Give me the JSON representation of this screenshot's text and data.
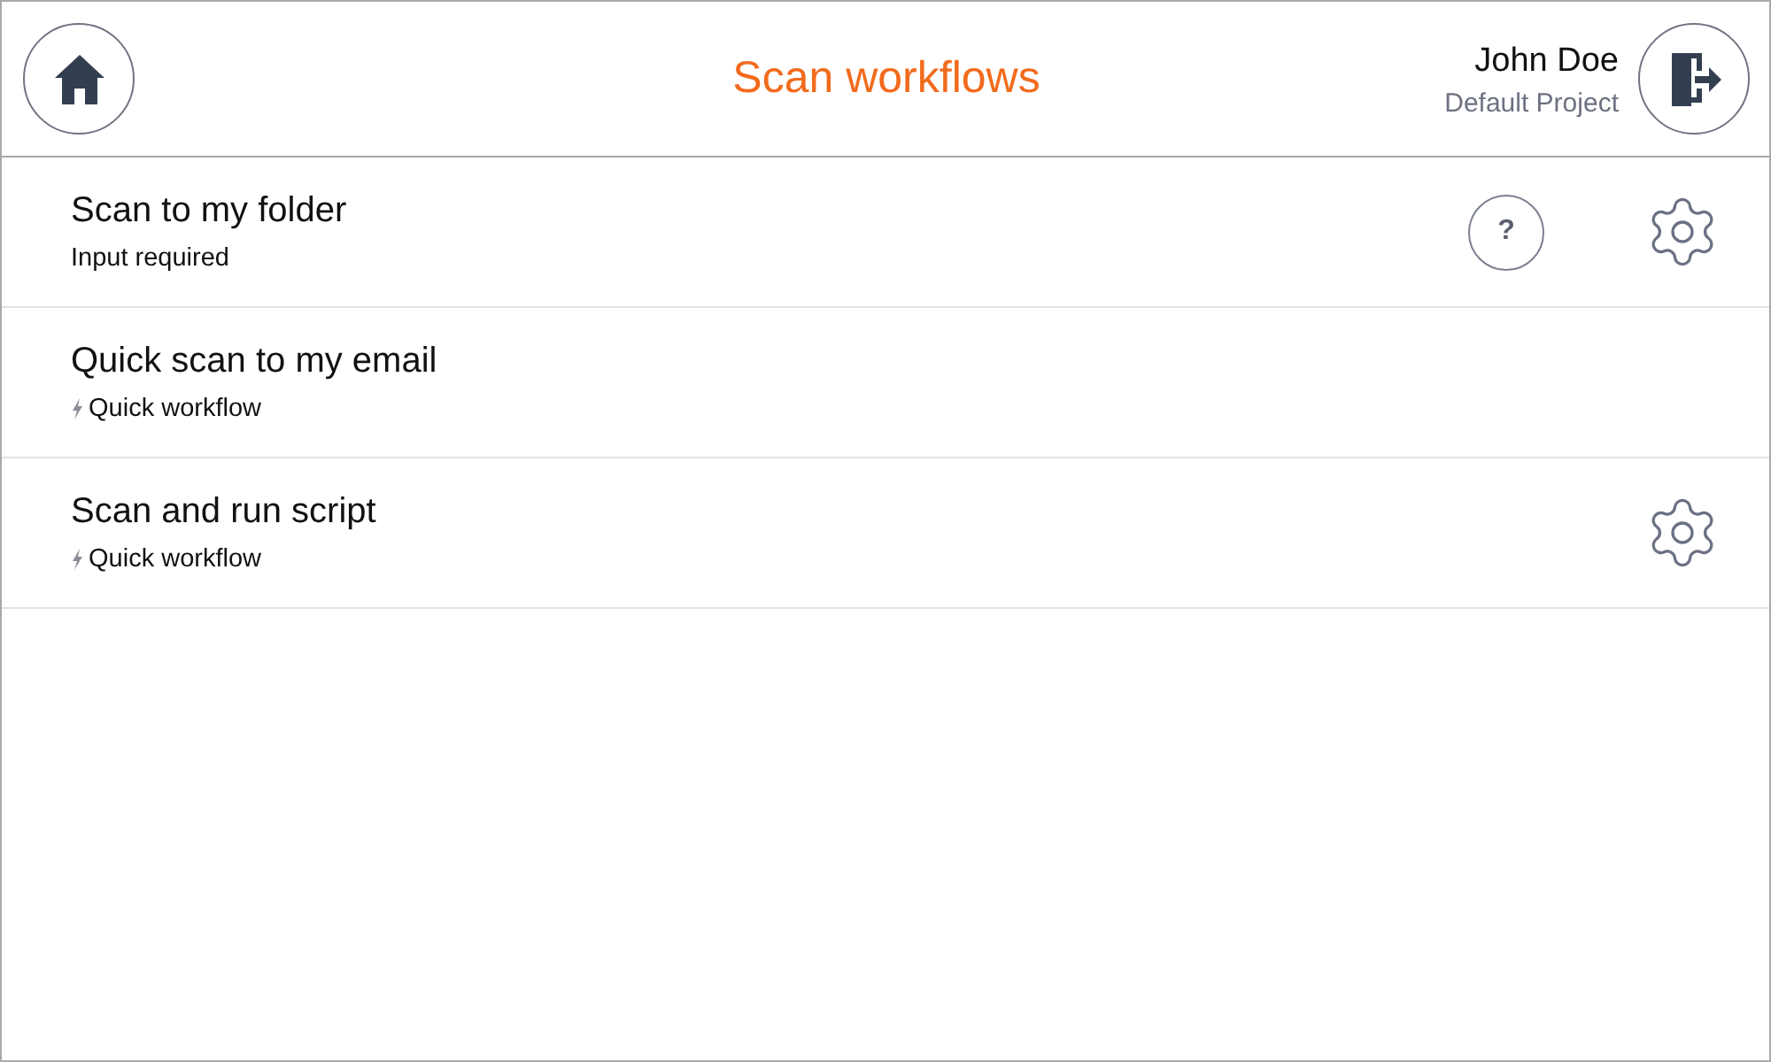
{
  "header": {
    "title": "Scan workflows",
    "user": {
      "name": "John Doe",
      "project": "Default Project"
    }
  },
  "workflows": [
    {
      "name": "Scan to my folder",
      "status": "Input required",
      "quick": false,
      "help": {
        "label": "?"
      },
      "settings": true
    },
    {
      "name": "Quick scan to my email",
      "status": "Quick workflow",
      "quick": true,
      "settings": false
    },
    {
      "name": "Scan and run script",
      "status": "Quick workflow",
      "quick": true,
      "settings": true
    }
  ]
}
